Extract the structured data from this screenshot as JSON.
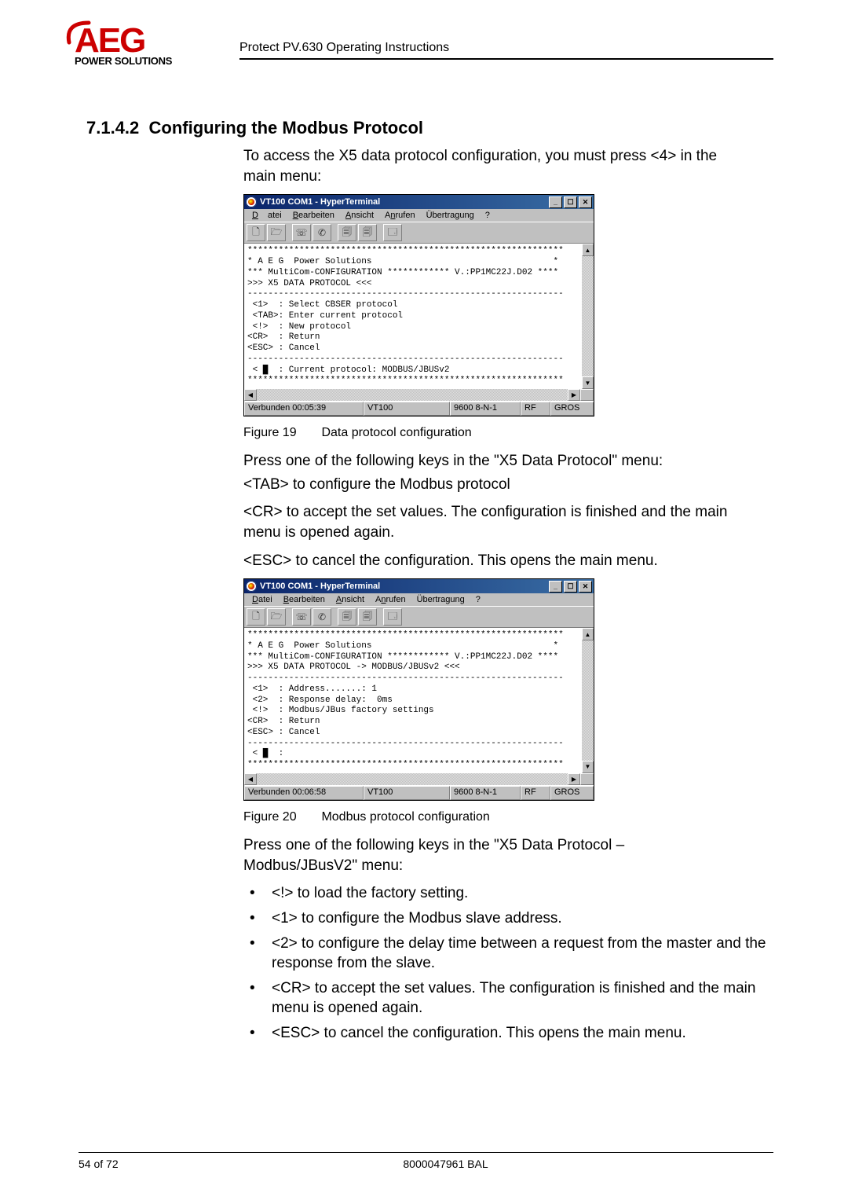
{
  "header": {
    "doc_title": "Protect PV.630 Operating Instructions"
  },
  "logo": {
    "brand": "AEG",
    "tagline": "POWER SOLUTIONS"
  },
  "section": {
    "number": "7.1.4.2",
    "title": "Configuring the Modbus Protocol"
  },
  "para1": "To access the X5 data protocol configuration, you must press <4> in the main menu:",
  "win1": {
    "title": "VT100 COM1 - HyperTerminal",
    "menu": {
      "m1": "Datei",
      "m2": "Bearbeiten",
      "m3": "Ansicht",
      "m4": "Anrufen",
      "m5": "Übertragung",
      "m6": "?"
    },
    "status": {
      "s1": "Verbunden 00:05:39",
      "s2": "VT100",
      "s3": "9600 8-N-1",
      "s4": "RF",
      "s5": "GROS"
    },
    "term": "*************************************************************\n* A E G  Power Solutions                                   *\n*** MultiCom-CONFIGURATION ************ V.:PP1MC22J.D02 ****\n>>> X5 DATA PROTOCOL <<<\n-------------------------------------------------------------\n <1>  : Select CBSER protocol\n <TAB>: Enter current protocol\n <!>  : New protocol\n<CR>  : Return\n<ESC> : Cancel\n-------------------------------------------------------------\n < █  : Current protocol: MODBUS/JBUSv2\n*************************************************************"
  },
  "fig1": {
    "no": "Figure 19",
    "cap": "Data protocol configuration"
  },
  "para2": "Press one of the following keys in the \"X5 Data Protocol\" menu:",
  "para2a": "<TAB> to configure the Modbus protocol",
  "para2b": "<CR> to accept the set values. The configuration is finished and the main menu is opened again.",
  "para2c": "<ESC> to cancel the configuration. This opens the main menu.",
  "win2": {
    "title": "VT100 COM1 - HyperTerminal",
    "menu": {
      "m1": "Datei",
      "m2": "Bearbeiten",
      "m3": "Ansicht",
      "m4": "Anrufen",
      "m5": "Übertragung",
      "m6": "?"
    },
    "status": {
      "s1": "Verbunden 00:06:58",
      "s2": "VT100",
      "s3": "9600 8-N-1",
      "s4": "RF",
      "s5": "GROS"
    },
    "term": "*************************************************************\n* A E G  Power Solutions                                   *\n*** MultiCom-CONFIGURATION ************ V.:PP1MC22J.D02 ****\n>>> X5 DATA PROTOCOL -> MODBUS/JBUSv2 <<<\n-------------------------------------------------------------\n <1>  : Address.......: 1\n <2>  : Response delay:  0ms\n <!>  : Modbus/JBus factory settings\n<CR>  : Return\n<ESC> : Cancel\n-------------------------------------------------------------\n < █  :\n*************************************************************"
  },
  "fig2": {
    "no": "Figure 20",
    "cap": "Modbus protocol configuration"
  },
  "para3": "Press one of the following keys in the \"X5 Data Protocol – Modbus/JBusV2\" menu:",
  "bullets": {
    "b1": "<!> to load the factory setting.",
    "b2": "<1> to configure the Modbus slave address.",
    "b3": "<2> to configure the delay time between a request from the master and the response from the slave.",
    "b4": "<CR> to accept the set values. The configuration is finished and the main menu is opened again.",
    "b5": "<ESC> to cancel the configuration. This opens the main menu."
  },
  "footer": {
    "left": "54 of 72",
    "center": "8000047961 BAL",
    "right": ""
  }
}
